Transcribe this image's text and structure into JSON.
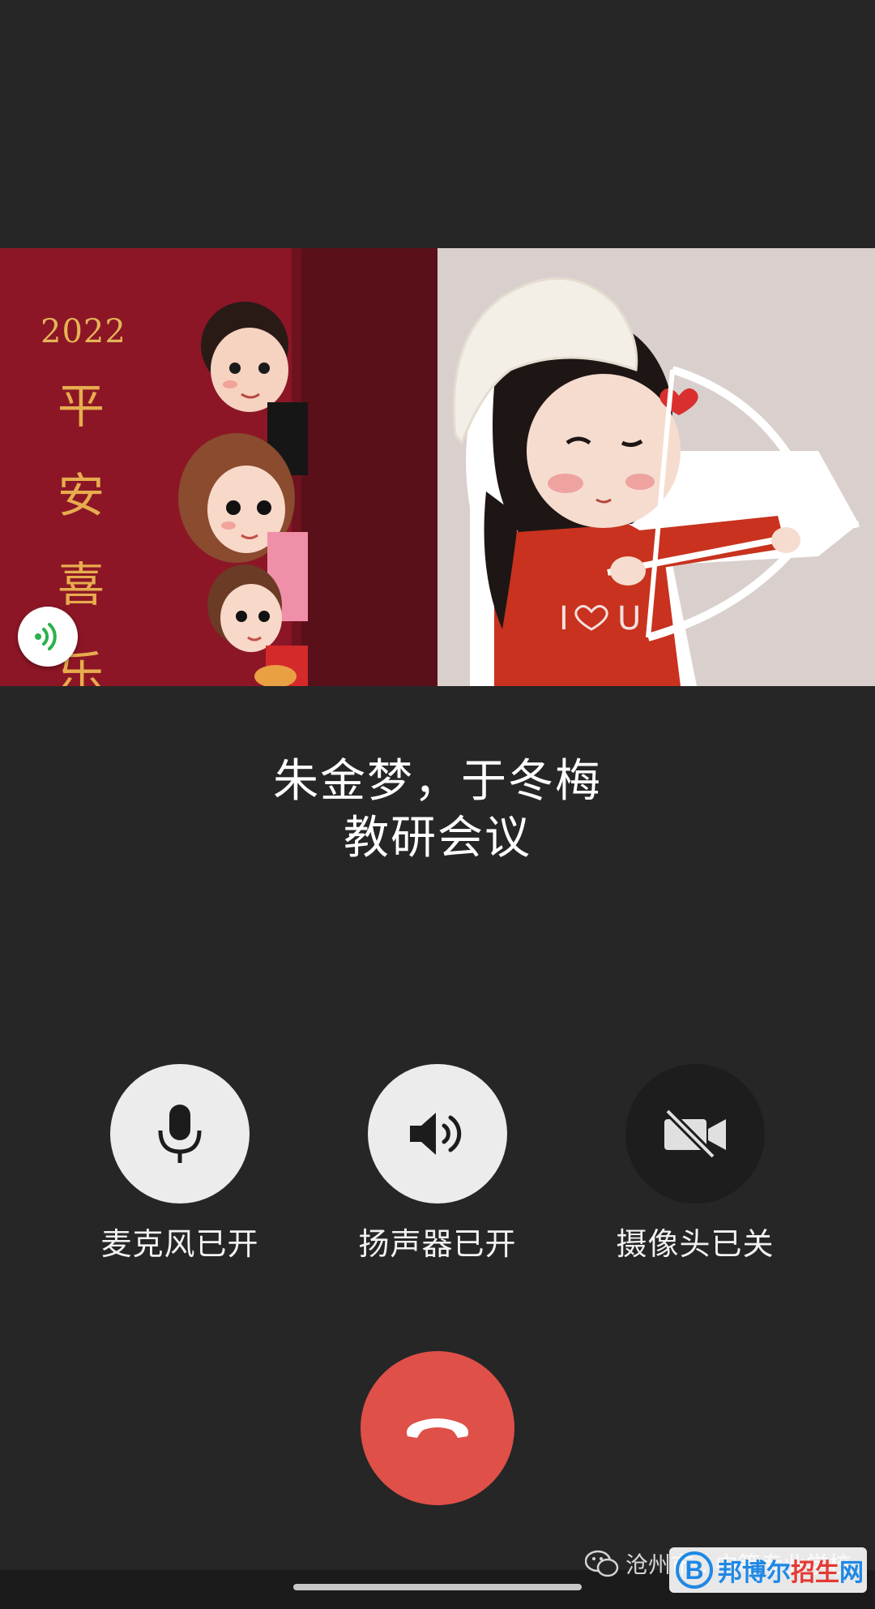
{
  "participants": {
    "left": {
      "card_year": "2022",
      "card_blessing": [
        "平",
        "安",
        "喜",
        "乐"
      ],
      "speaking": true
    },
    "right": {}
  },
  "call": {
    "names": "朱金梦，于冬梅",
    "meeting_title": "教研会议"
  },
  "controls": {
    "microphone": {
      "label": "麦克风已开",
      "state": "on",
      "icon": "microphone-icon"
    },
    "speaker": {
      "label": "扬声器已开",
      "state": "on",
      "icon": "speaker-icon"
    },
    "camera": {
      "label": "摄像头已关",
      "state": "off",
      "icon": "camera-off-icon"
    },
    "hangup": {
      "icon": "hang-up-icon"
    }
  },
  "watermark": {
    "text": "沧州市...中等专业学校",
    "brand_letter": "B",
    "brand_text_blue": "邦博尔",
    "brand_text_red": "招生",
    "brand_text_tail": "网"
  },
  "colors": {
    "background": "#262626",
    "button_light": "#ececec",
    "button_dark": "#1d1d1d",
    "hangup": "#df5048",
    "speaking_indicator": "#2bb24c"
  }
}
